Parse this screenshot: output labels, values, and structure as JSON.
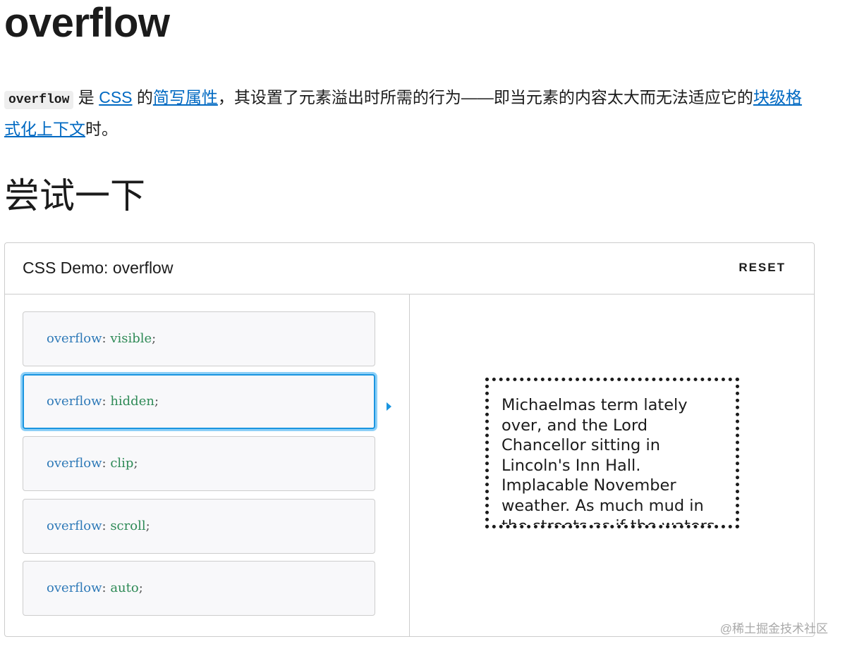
{
  "title": "overflow",
  "intro": {
    "code": "overflow",
    "t1": " 是 ",
    "link_css": "CSS",
    "t2": " 的",
    "link_shorthand": "简写属性",
    "t3": "，其设置了元素溢出时所需的行为——即当元素的内容太大而无法适应它的",
    "link_bfc": "块级格式化上下文",
    "t4": "时。"
  },
  "subtitle": "尝试一下",
  "demo": {
    "title": "CSS Demo: overflow",
    "reset_label": "RESET",
    "selected_index": 1,
    "choices": [
      {
        "prop": "overflow",
        "sep": ": ",
        "value": "visible",
        "end": ";"
      },
      {
        "prop": "overflow",
        "sep": ": ",
        "value": "hidden",
        "end": ";"
      },
      {
        "prop": "overflow",
        "sep": ": ",
        "value": "clip",
        "end": ";"
      },
      {
        "prop": "overflow",
        "sep": ": ",
        "value": "scroll",
        "end": ";"
      },
      {
        "prop": "overflow",
        "sep": ": ",
        "value": "auto",
        "end": ";"
      }
    ],
    "example_text": "Michaelmas term lately over, and the Lord Chancellor sitting in Lincoln's Inn Hall. Implacable November weather. As much mud in the streets as if the waters had but newly retired from the face of the earth."
  },
  "watermark": "@稀土掘金技术社区",
  "colors": {
    "link": "#0069c2",
    "selected_border": "#1a95e0",
    "code_property": "#2f7ab8",
    "code_value": "#2e8a56"
  },
  "icons": {
    "selected_indicator": "caret-right-icon"
  }
}
